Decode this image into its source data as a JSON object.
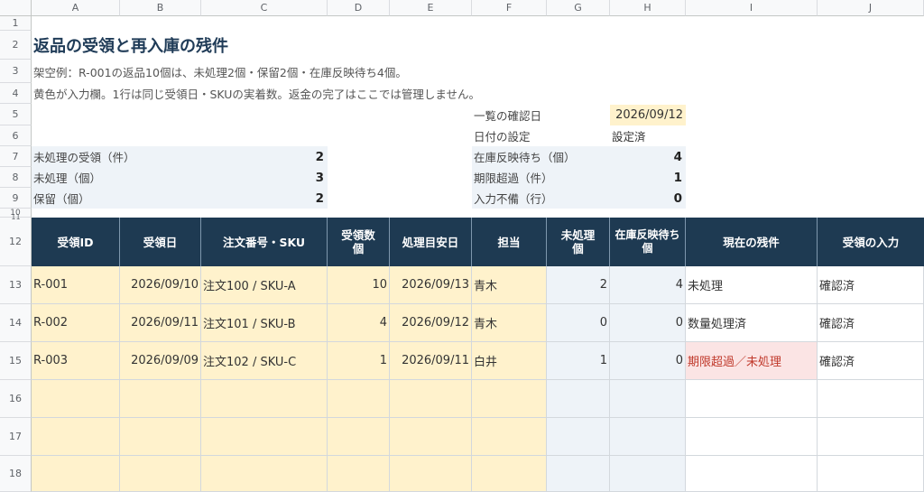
{
  "columns": [
    "A",
    "B",
    "C",
    "D",
    "E",
    "F",
    "G",
    "H",
    "I",
    "J"
  ],
  "rows": [
    "1",
    "2",
    "3",
    "4",
    "5",
    "6",
    "7",
    "8",
    "9",
    "10",
    "11",
    "12",
    "13",
    "14",
    "15",
    "16",
    "17",
    "18"
  ],
  "title": "返品の受領と再入庫の残件",
  "note1": "架空例：R-001の返品10個は、未処理2個・保留2個・在庫反映待ち4個。",
  "note2": "黄色が入力欄。1行は同じ受領日・SKUの実着数。返金の完了はここでは管理しません。",
  "summary_right": {
    "confirm_label": "一覧の確認日",
    "confirm_value": "2026/09/12",
    "date_setting_label": "日付の設定",
    "date_setting_value": "設定済",
    "pending_stock_label": "在庫反映待ち（個）",
    "pending_stock_value": "4",
    "overdue_label": "期限超過（件）",
    "overdue_value": "1",
    "incomplete_label": "入力不備（行）",
    "incomplete_value": "0"
  },
  "summary_left": {
    "unprocessed_receipts_label": "未処理の受領（件）",
    "unprocessed_receipts_value": "2",
    "unprocessed_qty_label": "未処理（個）",
    "unprocessed_qty_value": "3",
    "hold_label": "保留（個）",
    "hold_value": "2"
  },
  "table": {
    "headers": [
      "受領ID",
      "受領日",
      "注文番号・SKU",
      "受領数\n個",
      "処理目安日",
      "担当",
      "未処理\n個",
      "在庫反映待ち\n個",
      "現在の残件",
      "受領の入力"
    ],
    "rows": [
      {
        "id": "R-001",
        "date": "2026/09/10",
        "order": "注文100 / SKU-A",
        "qty": "10",
        "due": "2026/09/13",
        "owner": "青木",
        "unprocessed": "2",
        "pending": "4",
        "status": "未処理",
        "input": "確認済"
      },
      {
        "id": "R-002",
        "date": "2026/09/11",
        "order": "注文101 / SKU-B",
        "qty": "4",
        "due": "2026/09/12",
        "owner": "青木",
        "unprocessed": "0",
        "pending": "0",
        "status": "数量処理済",
        "input": "確認済"
      },
      {
        "id": "R-003",
        "date": "2026/09/09",
        "order": "注文102 / SKU-C",
        "qty": "1",
        "due": "2026/09/11",
        "owner": "白井",
        "unprocessed": "1",
        "pending": "0",
        "status": "期限超過／未処理",
        "input": "確認済"
      }
    ]
  },
  "colors": {
    "header_bg": "#1e3a52",
    "input_yellow": "#fff2cc",
    "calc_blue": "#eef3f8",
    "alert_red": "#fbe4e4"
  }
}
